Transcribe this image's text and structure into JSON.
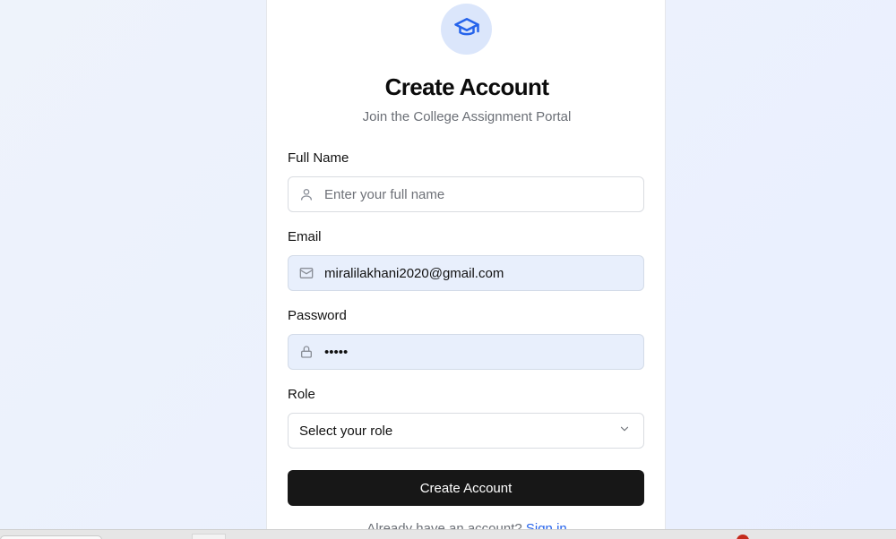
{
  "header": {
    "title": "Create Account",
    "subtitle": "Join the College Assignment Portal",
    "logo_icon": "graduation-cap-icon"
  },
  "form": {
    "full_name": {
      "label": "Full Name",
      "placeholder": "Enter your full name",
      "value": "",
      "icon": "user-icon"
    },
    "email": {
      "label": "Email",
      "value": "miralilakhani2020@gmail.com",
      "icon": "mail-icon"
    },
    "password": {
      "label": "Password",
      "value": "•••••",
      "icon": "lock-icon"
    },
    "role": {
      "label": "Role",
      "selected": "Select your role",
      "icon": "chevron-down-icon"
    },
    "submit_label": "Create Account"
  },
  "footer": {
    "prompt": "Already have an account?",
    "link": "Sign in"
  },
  "colors": {
    "accent": "#2563eb",
    "primary_button": "#171717",
    "autofill_bg": "#e8effc",
    "logo_bg": "#dbe6fb"
  }
}
